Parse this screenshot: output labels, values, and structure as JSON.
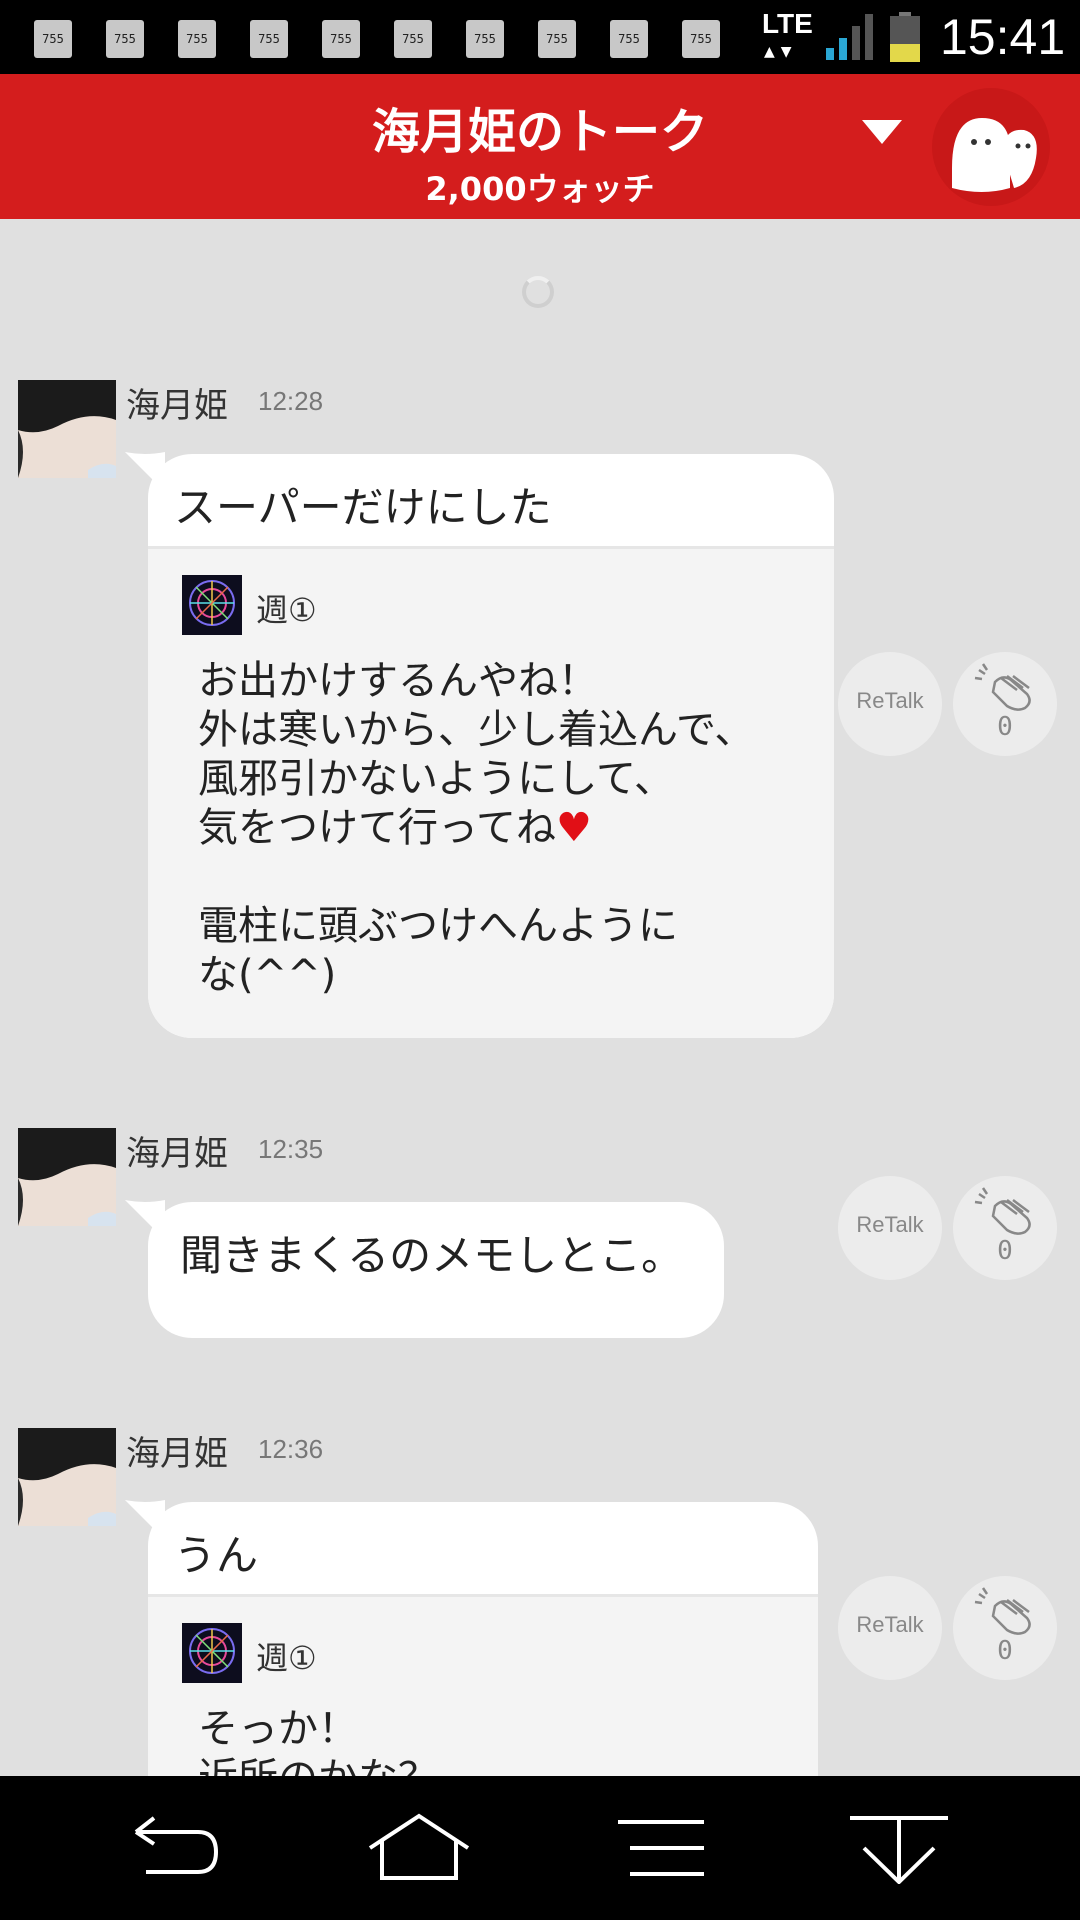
{
  "status_bar": {
    "notification_icons": [
      "755",
      "755",
      "755",
      "755",
      "755",
      "755",
      "755",
      "755",
      "755",
      "755"
    ],
    "network": "LTE",
    "time": "15:41"
  },
  "header": {
    "title": "海月姫のトーク",
    "subtitle": "2,000ウォッチ",
    "dropdown_icon": "triangle-down-icon",
    "avatar_icon": "ghost-mascot-icon",
    "bg_color": "#d41d1d"
  },
  "messages": [
    {
      "sender": "海月姫",
      "time": "12:28",
      "text": "スーパーだけにした",
      "quote": {
        "name": "週①",
        "text_lines": [
          "お出かけするんやね！",
          "外は寒いから、少し着込んで、",
          "風邪引かないようにして、",
          "気をつけて行ってね",
          "",
          "電柱に頭ぶつけへんように",
          "な(^^)"
        ],
        "heart": "♥"
      },
      "retalk_label": "ReTalk",
      "clap_count": "0"
    },
    {
      "sender": "海月姫",
      "time": "12:35",
      "text": "聞きまくるのメモしとこ。",
      "retalk_label": "ReTalk",
      "clap_count": "0"
    },
    {
      "sender": "海月姫",
      "time": "12:36",
      "text": "うん",
      "quote": {
        "name": "週①",
        "text_lines": [
          "そっか！",
          "近所のかな？"
        ]
      },
      "retalk_label": "ReTalk",
      "clap_count": "0"
    }
  ],
  "nav_bar": {
    "buttons": [
      "back-icon",
      "home-icon",
      "menu-icon",
      "scroll-bottom-icon"
    ]
  }
}
